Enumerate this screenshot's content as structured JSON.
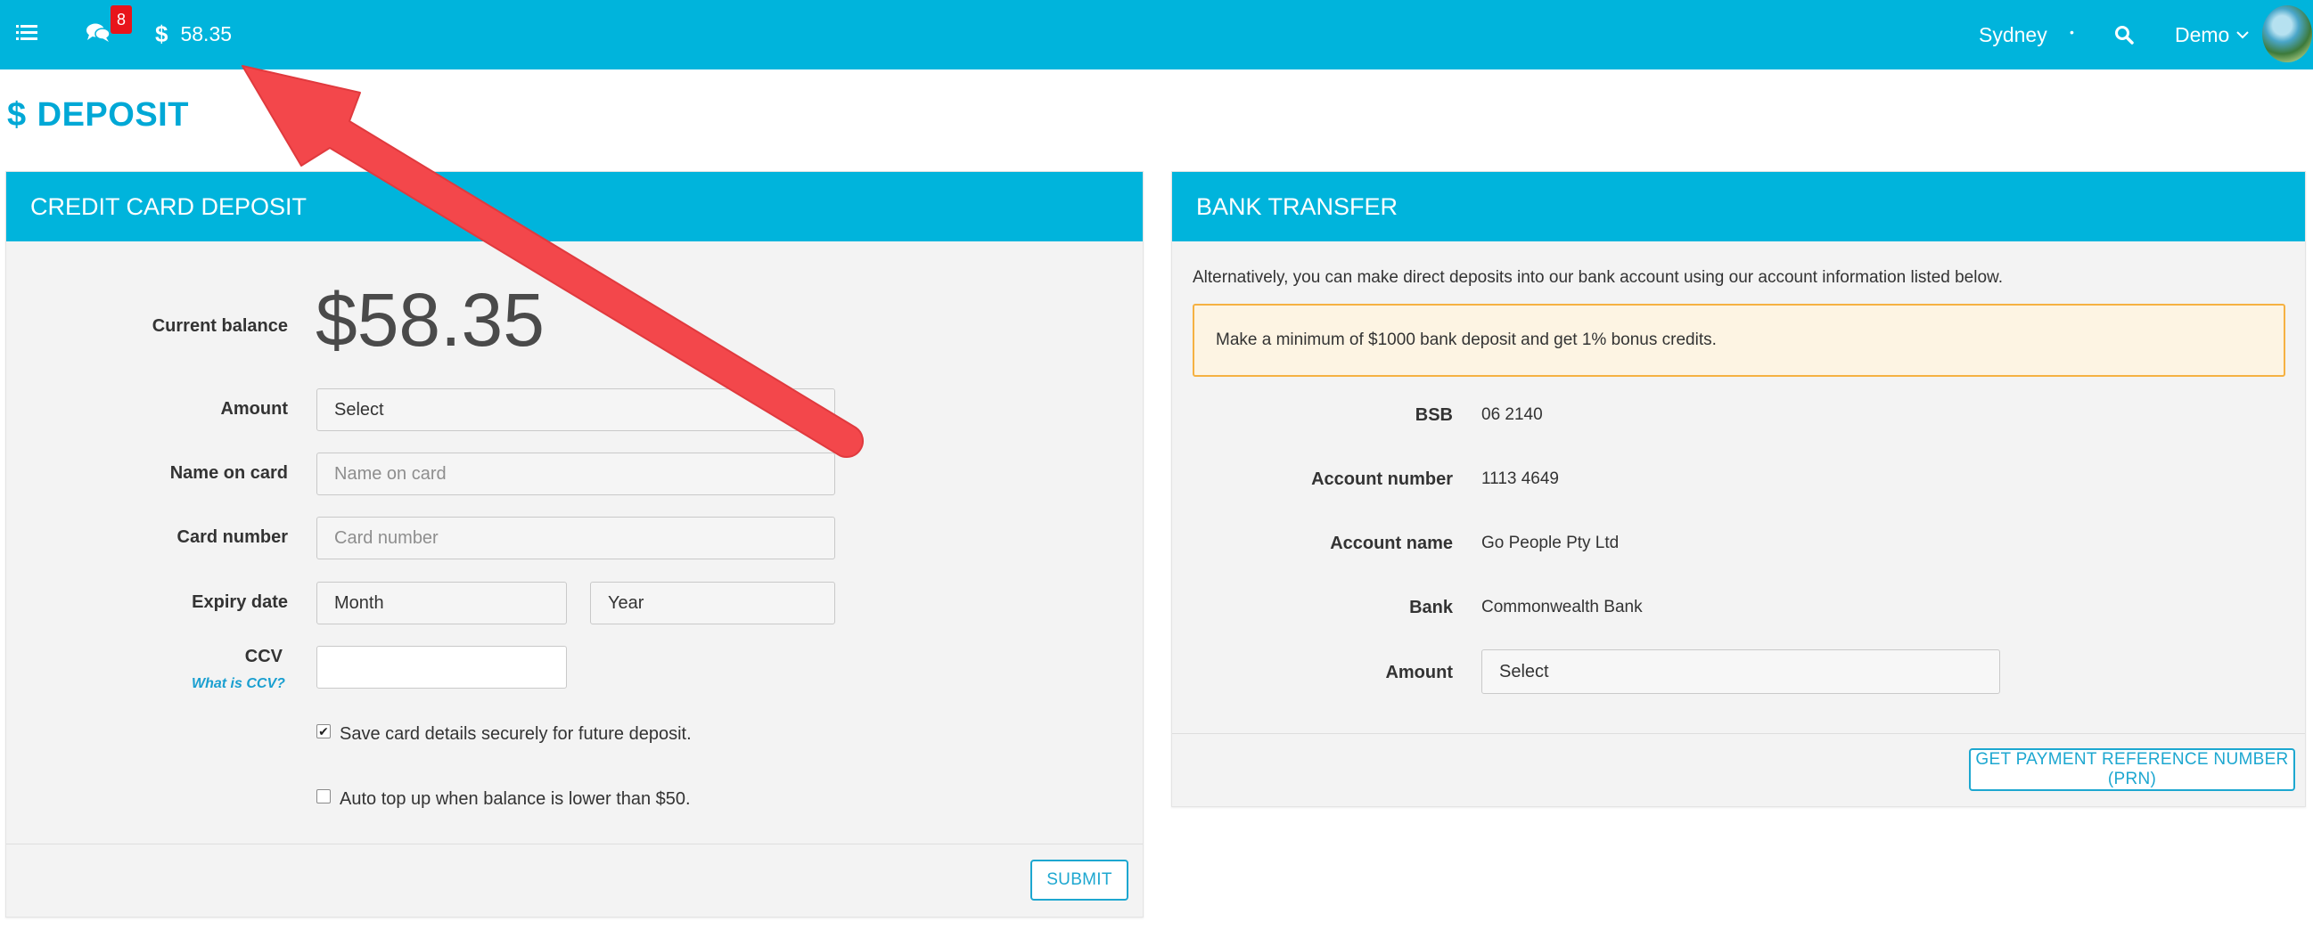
{
  "topbar": {
    "notification_count": "8",
    "balance_symbol": "$",
    "balance": "58.35",
    "location": "Sydney",
    "separator": "•",
    "user": "Demo",
    "colors": {
      "bar": "#00b4dc",
      "badge": "#e8151b"
    },
    "icons": [
      "menu-list-icon",
      "chat-bubbles-icon",
      "dollar-icon",
      "search-icon",
      "chevron-down-icon"
    ]
  },
  "page": {
    "title_symbol": "$",
    "title": "DEPOSIT"
  },
  "credit_card": {
    "heading": "CREDIT CARD DEPOSIT",
    "current_balance_label": "Current balance",
    "current_balance_value": "$58.35",
    "amount_label": "Amount",
    "amount_value": "Select",
    "name_label": "Name on card",
    "name_placeholder": "Name on card",
    "card_number_label": "Card number",
    "card_number_placeholder": "Card number",
    "expiry_label": "Expiry date",
    "month_value": "Month",
    "year_value": "Year",
    "ccv_label": "CCV",
    "ccv_link": "What is CCV?",
    "save_card_label": "Save card details securely for future deposit.",
    "save_card_checked": true,
    "auto_topup_label": "Auto top up when balance is lower than $50.",
    "auto_topup_checked": false,
    "submit_label": "SUBMIT"
  },
  "bank_transfer": {
    "heading": "BANK TRANSFER",
    "intro": "Alternatively, you can make direct deposits into our bank account using our account information listed below.",
    "promo": "Make a minimum of $1000 bank deposit and get 1% bonus credits.",
    "bsb_label": "BSB",
    "bsb_value": "06 2140",
    "account_number_label": "Account number",
    "account_number_value": "1113 4649",
    "account_name_label": "Account name",
    "account_name_value": "Go People Pty Ltd",
    "bank_label": "Bank",
    "bank_value": "Commonwealth Bank",
    "amount_label": "Amount",
    "amount_value": "Select",
    "prn_button": "GET PAYMENT REFERENCE NUMBER (PRN)"
  },
  "annotation": {
    "arrow_color": "#f3474b"
  }
}
